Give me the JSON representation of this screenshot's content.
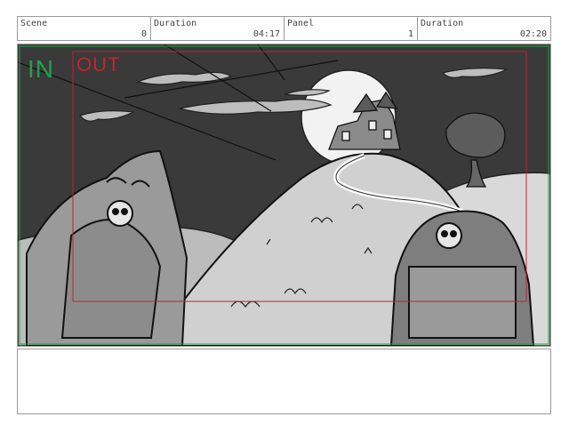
{
  "header": {
    "scene_label": "Scene",
    "scene_value": "0",
    "duration1_label": "Duration",
    "duration1_value": "04:17",
    "panel_label": "Panel",
    "panel_value": "1",
    "duration2_label": "Duration",
    "duration2_value": "02:20"
  },
  "frame": {
    "in_label": "IN",
    "out_label": "OUT"
  },
  "colors": {
    "in_frame": "#1fa34a",
    "out_frame": "#c0262d",
    "sky": "#3a3a3a",
    "border": "#9a9a9a"
  },
  "notes": {
    "text": ""
  }
}
